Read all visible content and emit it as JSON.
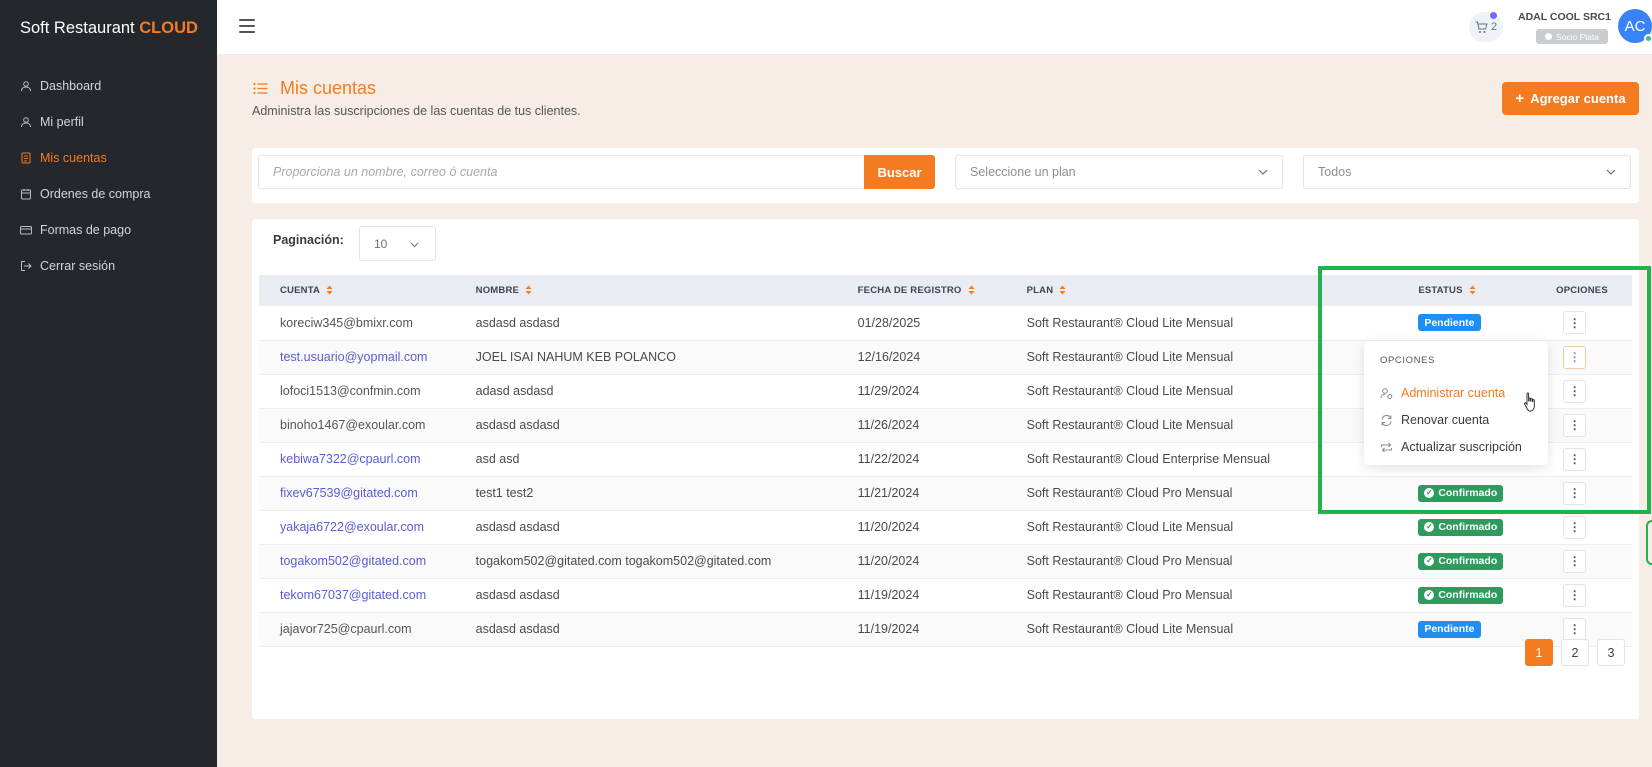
{
  "app": {
    "brand_main": "Soft Restaurant ",
    "brand_accent": "CLOUD"
  },
  "sidebar": {
    "items": [
      {
        "label": "Dashboard",
        "icon": "user-icon",
        "active": false
      },
      {
        "label": "Mi perfil",
        "icon": "user-icon",
        "active": false
      },
      {
        "label": "Mis cuentas",
        "icon": "document-icon",
        "active": true
      },
      {
        "label": "Ordenes de compra",
        "icon": "calendar-icon",
        "active": false
      },
      {
        "label": "Formas de pago",
        "icon": "credit-card-icon",
        "active": false
      },
      {
        "label": "Cerrar sesión",
        "icon": "logout-icon",
        "active": false
      }
    ]
  },
  "topbar": {
    "cart_count": "2",
    "user_name": "ADAL COOL SRC1",
    "user_badge": "Socio Plata",
    "avatar_initials": "AC"
  },
  "header": {
    "title": "Mis cuentas",
    "subtitle": "Administra las suscripciones de las cuentas de tus clientes.",
    "add_button": "Agregar cuenta"
  },
  "filters": {
    "search_placeholder": "Proporciona un nombre, correo ó cuenta",
    "search_button": "Buscar",
    "plan_select": "Seleccione un plan",
    "status_select": "Todos"
  },
  "table": {
    "pagination_label": "Paginación:",
    "page_size": "10",
    "columns": [
      "CUENTA",
      "NOMBRE",
      "FECHA DE REGISTRO",
      "PLAN",
      "ESTATUS",
      "OPCIONES"
    ],
    "rows": [
      {
        "cuenta": "koreciw345@bmixr.com",
        "nombre": "asdasd asdasd",
        "fecha": "01/28/2025",
        "plan": "Soft Restaurant® Cloud Lite Mensual",
        "estatus": "Pendiente"
      },
      {
        "cuenta": "test.usuario@yopmail.com",
        "nombre": "JOEL ISAI NAHUM KEB POLANCO",
        "fecha": "12/16/2024",
        "plan": "Soft Restaurant® Cloud Lite Mensual",
        "estatus": ""
      },
      {
        "cuenta": "lofoci1513@confmin.com",
        "nombre": "adasd asdasd",
        "fecha": "11/29/2024",
        "plan": "Soft Restaurant® Cloud Lite Mensual",
        "estatus": ""
      },
      {
        "cuenta": "binoho1467@exoular.com",
        "nombre": "asdasd asdasd",
        "fecha": "11/26/2024",
        "plan": "Soft Restaurant® Cloud Lite Mensual",
        "estatus": ""
      },
      {
        "cuenta": "kebiwa7322@cpaurl.com",
        "nombre": "asd asd",
        "fecha": "11/22/2024",
        "plan": "Soft Restaurant® Cloud Enterprise Mensual",
        "estatus": ""
      },
      {
        "cuenta": "fixev67539@gitated.com",
        "nombre": "test1 test2",
        "fecha": "11/21/2024",
        "plan": "Soft Restaurant® Cloud Pro Mensual",
        "estatus": "Confirmado"
      },
      {
        "cuenta": "yakaja6722@exoular.com",
        "nombre": "asdasd asdasd",
        "fecha": "11/20/2024",
        "plan": "Soft Restaurant® Cloud Lite Mensual",
        "estatus": "Confirmado"
      },
      {
        "cuenta": "togakom502@gitated.com",
        "nombre": "togakom502@gitated.com togakom502@gitated.com",
        "fecha": "11/20/2024",
        "plan": "Soft Restaurant® Cloud Pro Mensual",
        "estatus": "Confirmado"
      },
      {
        "cuenta": "tekom67037@gitated.com",
        "nombre": "asdasd asdasd",
        "fecha": "11/19/2024",
        "plan": "Soft Restaurant® Cloud Pro Mensual",
        "estatus": "Confirmado"
      },
      {
        "cuenta": "jajavor725@cpaurl.com",
        "nombre": "asdasd asdasd",
        "fecha": "11/19/2024",
        "plan": "Soft Restaurant® Cloud Lite Mensual",
        "estatus": "Pendiente"
      }
    ],
    "pages": [
      "1",
      "2",
      "3"
    ]
  },
  "dropdown": {
    "header": "OPCIONES",
    "items": [
      "Administrar cuenta",
      "Renovar cuenta",
      "Actualizar suscripción"
    ]
  },
  "colors": {
    "accent": "#f47b20",
    "sidebar": "#24282c",
    "pending": "#1e8ff0",
    "confirmed": "#2e9a5d",
    "highlight": "#22b24c"
  }
}
